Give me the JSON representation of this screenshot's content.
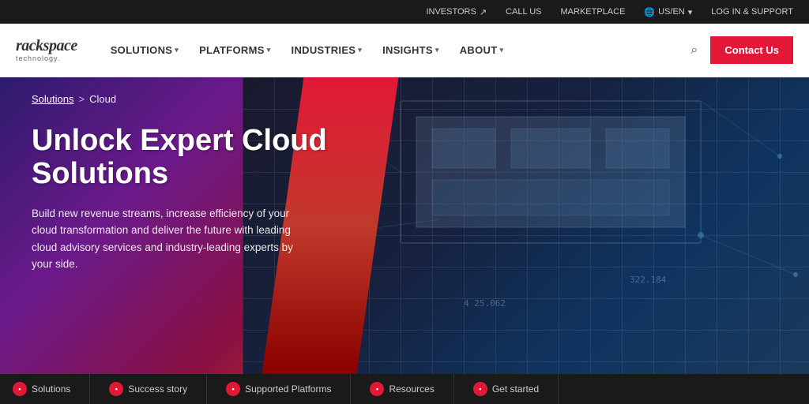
{
  "utility_bar": {
    "investors_label": "INVESTORS",
    "investors_icon": "↗",
    "call_us_label": "CALL US",
    "marketplace_label": "MARKETPLACE",
    "locale_label": "🌐 US/EN",
    "locale_icon": "▾",
    "login_label": "LOG IN & SUPPORT"
  },
  "nav": {
    "logo_text": "rackspace",
    "logo_sub": "technology",
    "items": [
      {
        "label": "SOLUTIONS",
        "has_dropdown": true
      },
      {
        "label": "PLATFORMS",
        "has_dropdown": true
      },
      {
        "label": "INDUSTRIES",
        "has_dropdown": true
      },
      {
        "label": "INSIGHTS",
        "has_dropdown": true
      },
      {
        "label": "ABOUT",
        "has_dropdown": true
      }
    ],
    "contact_label": "Contact Us"
  },
  "breadcrumb": {
    "link": "Solutions",
    "separator": ">",
    "current": "Cloud"
  },
  "hero": {
    "title": "Unlock Expert Cloud Solutions",
    "subtitle": "Build new revenue streams, increase efficiency of your cloud transformation and deliver the future with leading cloud advisory services and industry-leading experts by your side.",
    "data_point_1": "4 25 062",
    "data_point_2": "322 184"
  },
  "tab_bar": {
    "items": [
      {
        "label": "Solutions"
      },
      {
        "label": "Success story"
      },
      {
        "label": "Supported Platforms"
      },
      {
        "label": "Resources"
      },
      {
        "label": "Get started"
      }
    ]
  }
}
